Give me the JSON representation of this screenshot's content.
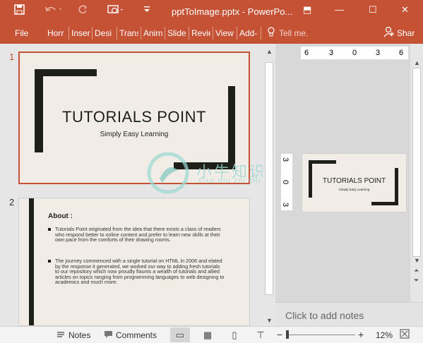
{
  "titlebar": {
    "title": "pptToImage.pptx  -  PowerPo...",
    "icons": [
      "save-icon",
      "undo-icon",
      "redo-icon",
      "present-from-start-icon",
      "customize-icon"
    ]
  },
  "window_controls": {
    "restore_ribbon": "⬒",
    "minimize": "—",
    "maximize": "☐",
    "close": "✕"
  },
  "ribbon": {
    "tabs": [
      "File",
      "Horr",
      "Inser",
      "Desi",
      "Trans",
      "Anim",
      "Slide",
      "Revie",
      "View",
      "Add-"
    ],
    "tell_me": "Tell me.",
    "share": "Shar"
  },
  "thumbnails": [
    {
      "number": "1",
      "title": "TUTORIALS POINT",
      "subtitle": "Simply Easy Learning"
    },
    {
      "number": "2",
      "heading": "About :",
      "bullets": [
        "Tutorials Point originated from the idea that there exists a class of readers who respond better to online content and prefer to learn new skills at their own pace from the comforts of their drawing rooms.",
        "The journey commenced with a single tutorial on HTML in 2006 and elated by the response it generated, we worked our way to adding fresh tutorials to our repository which now proudly flaunts a wealth of tutorials and allied articles on topics ranging from programming languages to web designing to academics and much more."
      ]
    }
  ],
  "ruler": {
    "horizontal": [
      "6",
      "3",
      "0",
      "3",
      "6"
    ],
    "vertical": [
      "3",
      "0",
      "3"
    ]
  },
  "main_slide": {
    "title": "TUTORIALS POINT",
    "subtitle": "Simply Easy Learning"
  },
  "notes_placeholder": "Click to add notes",
  "watermark": {
    "cn": "小牛知识库",
    "pinyin": "XIAO NIU ZHI SHI KU"
  },
  "statusbar": {
    "notes": "Notes",
    "comments": "Comments",
    "zoom": "12%"
  }
}
